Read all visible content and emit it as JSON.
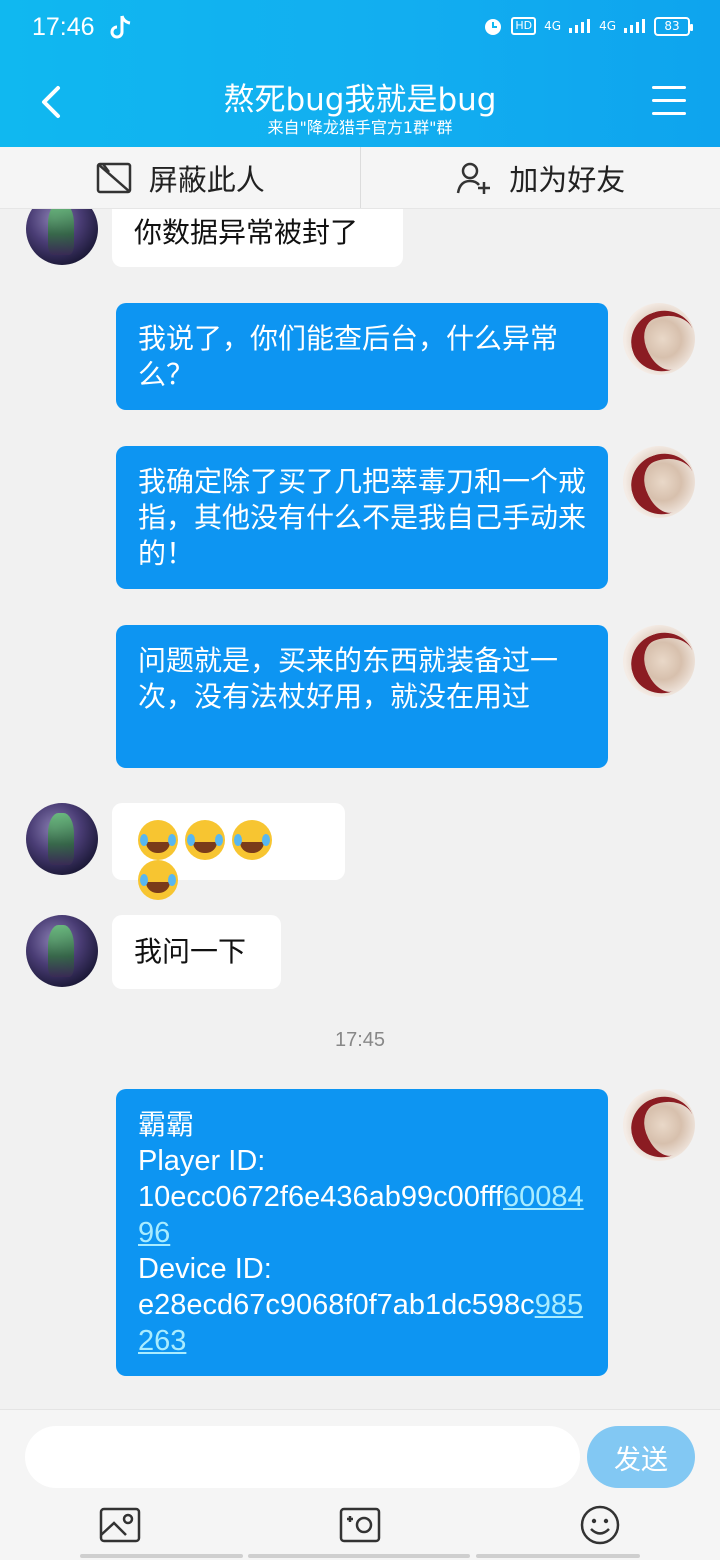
{
  "status_bar": {
    "time": "17:46",
    "signal1": "4G",
    "signal2": "4G",
    "hd": "HD",
    "battery": "83"
  },
  "header": {
    "title": "熬死bug我就是bug",
    "subtitle": "来自\"降龙猎手官方1群\"群"
  },
  "actions": {
    "block_label": "屏蔽此人",
    "add_friend_label": "加为好友"
  },
  "messages": [
    {
      "from": "other",
      "text": "你数据异常被封了"
    },
    {
      "from": "me",
      "text": "我说了，你们能查后台，什么异常么？"
    },
    {
      "from": "me",
      "text": "我确定除了买了几把萃毒刀和一个戒指，其他没有什么不是我自己手动来的！"
    },
    {
      "from": "me",
      "text": "问题就是，买来的东西就装备过一次，没有法杖好用，就没在用过"
    },
    {
      "from": "other",
      "emoji_count": 4
    },
    {
      "from": "other",
      "text": "我问一下"
    }
  ],
  "timestamp": "17:45",
  "info_message": {
    "name": "霸霸",
    "player_label": "Player ID:",
    "player_id_plain": "10ecc0672f6e436ab99c00fff",
    "player_id_link": "6008496",
    "device_label": "Device ID:",
    "device_id_plain": "e28ecd67c9068f0f7ab1dc598c",
    "device_id_link": "985263"
  },
  "input": {
    "placeholder": "",
    "send_label": "发送"
  },
  "toolbar": {
    "icons": [
      "image-icon",
      "camera-icon",
      "emoji-icon"
    ]
  }
}
